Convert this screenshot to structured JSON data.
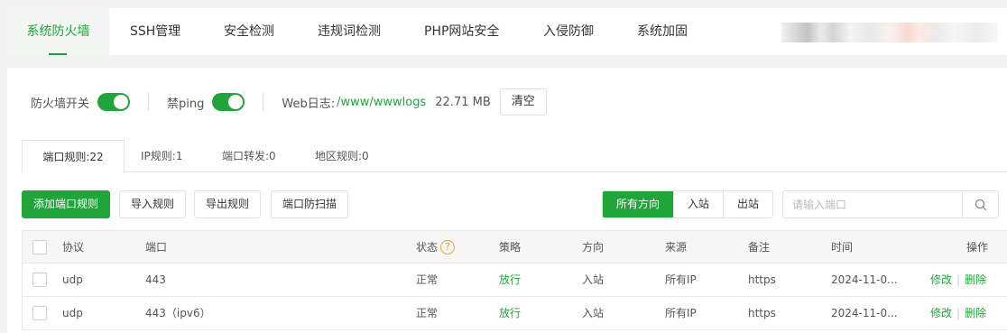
{
  "top_tabs": [
    {
      "label": "系统防火墙",
      "active": true
    },
    {
      "label": "SSH管理"
    },
    {
      "label": "安全检测"
    },
    {
      "label": "违规词检测"
    },
    {
      "label": "PHP网站安全"
    },
    {
      "label": "入侵防御"
    },
    {
      "label": "系统加固"
    }
  ],
  "settings": {
    "firewall_label": "防火墙开关",
    "firewall_on": true,
    "ping_label": "禁ping",
    "ping_on": true,
    "weblog_label": "Web日志:",
    "weblog_path": "/www/wwwlogs",
    "weblog_size": "22.71 MB",
    "clear_label": "清空"
  },
  "sub_tabs": [
    {
      "label": "端口规则:22",
      "active": true
    },
    {
      "label": "IP规则:1"
    },
    {
      "label": "端口转发:0"
    },
    {
      "label": "地区规则:0"
    }
  ],
  "toolbar": {
    "add_label": "添加端口规则",
    "import_label": "导入规则",
    "export_label": "导出规则",
    "scan_label": "端口防扫描",
    "direction_options": [
      "所有方向",
      "入站",
      "出站"
    ],
    "direction_selected": "所有方向",
    "search_placeholder": "请输入端口",
    "search_icon": "search-icon"
  },
  "table": {
    "headers": {
      "protocol": "协议",
      "port": "端口",
      "status": "状态",
      "policy": "策略",
      "direction": "方向",
      "source": "来源",
      "remark": "备注",
      "time": "时间",
      "actions": "操作"
    },
    "status_help_icon": "question-icon",
    "rows": [
      {
        "protocol": "udp",
        "port": "443",
        "status": "正常",
        "policy": "放行",
        "direction": "入站",
        "source": "所有IP",
        "remark": "https",
        "time": "2024-11-0...",
        "edit": "修改",
        "delete": "删除"
      },
      {
        "protocol": "udp",
        "port": "443（ipv6）",
        "status": "正常",
        "policy": "放行",
        "direction": "入站",
        "source": "所有IP",
        "remark": "https",
        "time": "2024-11-0...",
        "edit": "修改",
        "delete": "删除"
      }
    ]
  },
  "colors": {
    "accent": "#20a53a",
    "warning": "#f0a030"
  }
}
